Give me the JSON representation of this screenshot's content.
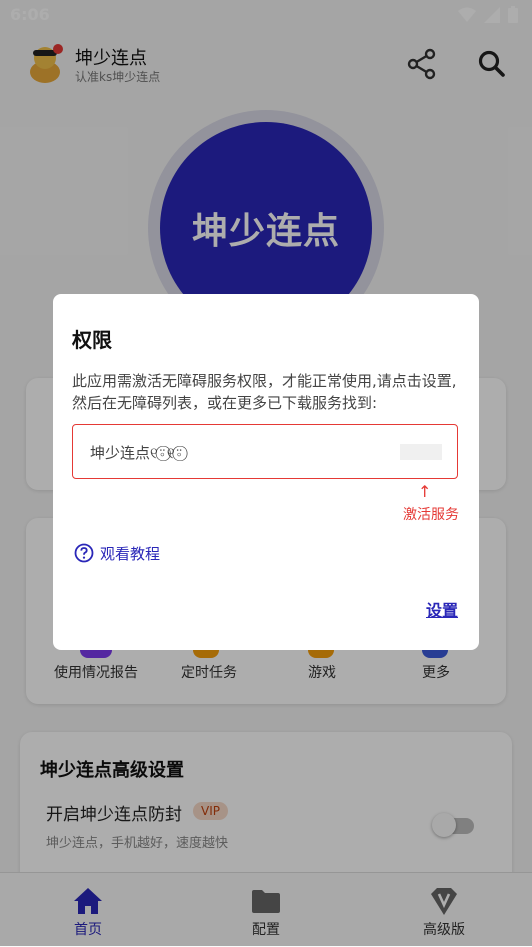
{
  "status_bar": {
    "time": "6:06"
  },
  "app_bar": {
    "title": "坤少连点",
    "subtitle": "认准ks坤少连点"
  },
  "main_button": {
    "label": "坤少连点"
  },
  "grid": [
    {
      "label": "使用情况报告",
      "color": "#7c3aed"
    },
    {
      "label": "定时任务",
      "color": "#f59e0b"
    },
    {
      "label": "游戏",
      "color": "#f59e0b"
    },
    {
      "label": "更多",
      "color": "#3b5bdb"
    }
  ],
  "advanced": {
    "title": "坤少连点高级设置",
    "item_label": "开启坤少连点防封",
    "vip_badge": "VIP",
    "item_desc": "坤少连点，手机越好，速度越快",
    "toggle_on": false
  },
  "bottom_nav": [
    {
      "label": "首页",
      "active": true
    },
    {
      "label": "配置",
      "active": false
    },
    {
      "label": "高级版",
      "active": false
    }
  ],
  "dialog": {
    "title": "权限",
    "message": "此应用需激活无障碍服务权限，才能正常使用,请点击设置,然后在无障碍列表，或在更多已下载服务找到:",
    "service_name": "坤少连点୧⍤⃝୧⍤⃝",
    "arrow": "↑",
    "activate_hint": "激活服务",
    "tutorial_link": "观看教程",
    "settings_button": "设置"
  },
  "colors": {
    "accent": "#2a27b8",
    "error": "#e53935"
  }
}
